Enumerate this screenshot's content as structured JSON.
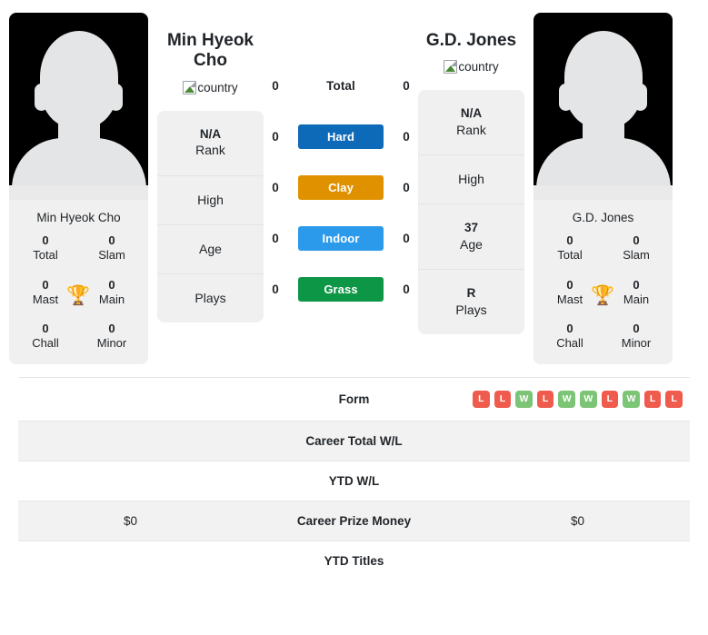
{
  "colors": {
    "hard": "#0d6ab8",
    "clay": "#e09100",
    "indoor": "#2c9aeb",
    "grass": "#0e9647",
    "win": "#7cc576",
    "loss": "#ef5b4c",
    "trophy": "#3e74b8",
    "card_bg": "#f0f0f0",
    "stripe": "#f2f2f2"
  },
  "players": {
    "left": {
      "title": "Min Hyeok Cho",
      "country_alt": "country",
      "card_name": "Min Hyeok Cho",
      "titles": [
        {
          "value": "0",
          "label": "Total"
        },
        {
          "value": "0",
          "label": "Slam"
        },
        {
          "value": "0",
          "label": "Mast"
        },
        {
          "value": "0",
          "label": "Main"
        },
        {
          "value": "0",
          "label": "Chall"
        },
        {
          "value": "0",
          "label": "Minor"
        }
      ],
      "info": [
        {
          "value": "N/A",
          "label": "Rank"
        },
        {
          "value": "",
          "label": "High"
        },
        {
          "value": "",
          "label": "Age"
        },
        {
          "value": "",
          "label": "Plays"
        }
      ],
      "surface_counts": [
        "0",
        "0",
        "0",
        "0",
        "0"
      ],
      "career_prize_money": "$0"
    },
    "right": {
      "title": "G.D. Jones",
      "country_alt": "country",
      "card_name": "G.D. Jones",
      "titles": [
        {
          "value": "0",
          "label": "Total"
        },
        {
          "value": "0",
          "label": "Slam"
        },
        {
          "value": "0",
          "label": "Mast"
        },
        {
          "value": "0",
          "label": "Main"
        },
        {
          "value": "0",
          "label": "Chall"
        },
        {
          "value": "0",
          "label": "Minor"
        }
      ],
      "info": [
        {
          "value": "N/A",
          "label": "Rank"
        },
        {
          "value": "",
          "label": "High"
        },
        {
          "value": "37",
          "label": "Age"
        },
        {
          "value": "R",
          "label": "Plays"
        }
      ],
      "surface_counts": [
        "0",
        "0",
        "0",
        "0",
        "0"
      ],
      "career_prize_money": "$0"
    }
  },
  "surfaces": [
    {
      "label": "Total",
      "type": "plain"
    },
    {
      "label": "Hard",
      "type": "hard"
    },
    {
      "label": "Clay",
      "type": "clay"
    },
    {
      "label": "Indoor",
      "type": "indoor"
    },
    {
      "label": "Grass",
      "type": "grass"
    }
  ],
  "comparison_rows": [
    {
      "label": "Form",
      "left": "",
      "right": "",
      "kind": "form",
      "striped": false
    },
    {
      "label": "Career Total W/L",
      "left": "",
      "right": "",
      "kind": "text",
      "striped": true
    },
    {
      "label": "YTD W/L",
      "left": "",
      "right": "",
      "kind": "text",
      "striped": false
    },
    {
      "label": "Career Prize Money",
      "left": "$0",
      "right": "$0",
      "kind": "text",
      "striped": true
    },
    {
      "label": "YTD Titles",
      "left": "",
      "right": "",
      "kind": "text",
      "striped": false
    }
  ],
  "form": {
    "right_results": [
      "L",
      "L",
      "W",
      "L",
      "W",
      "W",
      "L",
      "W",
      "L",
      "L"
    ],
    "left_results": []
  }
}
